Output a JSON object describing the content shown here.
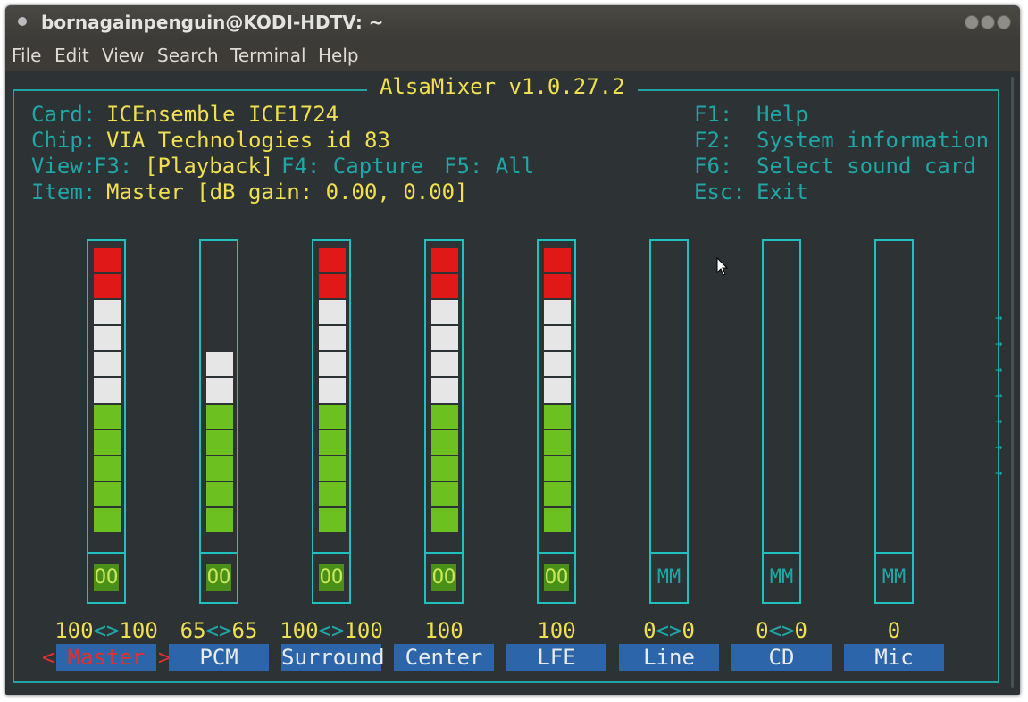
{
  "window": {
    "title": "bornagainpenguin@KODI-HDTV: ~"
  },
  "menu": [
    "File",
    "Edit",
    "View",
    "Search",
    "Terminal",
    "Help"
  ],
  "mixer": {
    "title": "AlsaMixer v1.0.27.2",
    "card_label": "Card:",
    "card_value": "ICEnsemble ICE1724",
    "chip_label": "Chip:",
    "chip_value": "VIA Technologies id 83",
    "view_label": "View:",
    "view_f3": "F3:",
    "view_playback": "[Playback]",
    "view_f4": "F4: Capture",
    "view_f5": "F5: All",
    "item_label": "Item:",
    "item_value": "Master [dB gain: 0.00, 0.00]",
    "keys": [
      {
        "key": "F1:",
        "action": "Help"
      },
      {
        "key": "F2:",
        "action": "System information"
      },
      {
        "key": "F6:",
        "action": "Select sound card"
      },
      {
        "key": "Esc:",
        "action": "Exit"
      }
    ]
  },
  "channels": [
    {
      "name": "Master",
      "level_text": "100<>100",
      "volume_percent": 100,
      "mute": "OO",
      "selected": true
    },
    {
      "name": "PCM",
      "level_text": "65<>65",
      "volume_percent": 65,
      "mute": "OO",
      "selected": false
    },
    {
      "name": "Surround",
      "level_text": "100<>100",
      "volume_percent": 100,
      "mute": "OO",
      "selected": false
    },
    {
      "name": "Center",
      "level_text": "100",
      "volume_percent": 100,
      "mute": "OO",
      "selected": false
    },
    {
      "name": "LFE",
      "level_text": "100",
      "volume_percent": 100,
      "mute": "OO",
      "selected": false
    },
    {
      "name": "Line",
      "level_text": "0<>0",
      "volume_percent": 0,
      "mute": "MM",
      "selected": false
    },
    {
      "name": "CD",
      "level_text": "0<>0",
      "volume_percent": 0,
      "mute": "MM",
      "selected": false
    },
    {
      "name": "Mic",
      "level_text": "0",
      "volume_percent": 0,
      "mute": "MM",
      "selected": false
    }
  ],
  "selection_marks": {
    "left": "<",
    "right": ">"
  },
  "scroll_arrow": "→",
  "colors": {
    "frame": "#20a5a5",
    "label": "#1fa7a7",
    "value": "#f0e050",
    "meter_red": "#e01818",
    "meter_white": "#e6e6e6",
    "meter_green": "#6cc020",
    "name_bg": "#2c65a9",
    "selected_name": "#e03030"
  }
}
